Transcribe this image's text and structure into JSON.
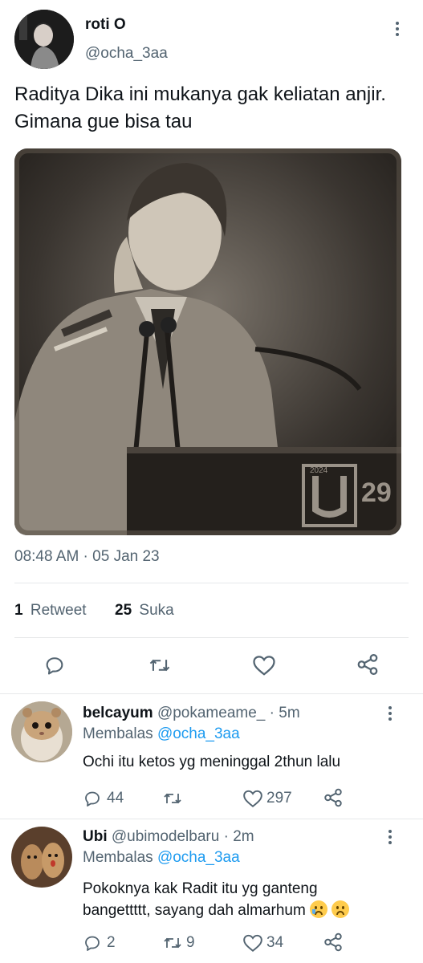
{
  "tweet": {
    "display_name": "roti O",
    "handle": "@ocha_3aa",
    "text": "Raditya Dika ini mukanya gak keliatan anjir. Gimana gue bisa tau",
    "timestamp": "08:48 AM · 05 Jan 23",
    "retweets_count": "1",
    "retweets_label": "Retweet",
    "likes_count": "25",
    "likes_label": "Suka",
    "photo_overlay_text": "2024",
    "photo_corner_text": "29"
  },
  "replies": [
    {
      "display_name": "belcayum",
      "handle": "@pokameame_",
      "time": "· 5m",
      "replying_prefix": "Membalas",
      "replying_to": "@ocha_3aa",
      "text": "Ochi itu ketos yg meninggal 2thun lalu",
      "reply_count": "44",
      "retweet_count": "",
      "like_count": "297"
    },
    {
      "display_name": "Ubi",
      "handle": "@ubimodelbaru",
      "time": "· 2m",
      "replying_prefix": "Membalas",
      "replying_to": "@ocha_3aa",
      "text_line1": "Pokoknya kak Radit itu yg ganteng",
      "text_line2": "bangettttt, sayang dah almarhum",
      "reply_count": "2",
      "retweet_count": "9",
      "like_count": "34"
    }
  ],
  "colors": {
    "accent": "#1d9bf0",
    "muted": "#536471",
    "text": "#0f1419",
    "divider": "#e7e9ea"
  },
  "icons": [
    "more-icon",
    "reply-icon",
    "retweet-icon",
    "like-icon",
    "share-icon"
  ]
}
